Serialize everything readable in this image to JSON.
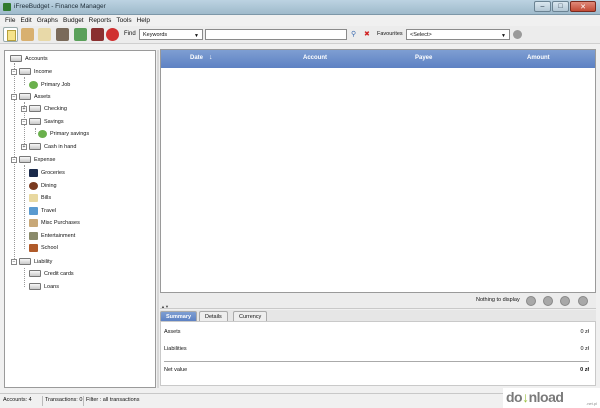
{
  "window": {
    "title": "iFreeBudget - Finance Manager"
  },
  "menu": [
    "File",
    "Edit",
    "Graphs",
    "Budget",
    "Reports",
    "Tools",
    "Help"
  ],
  "toolbar": {
    "find_label": "Find",
    "find_select": "Keywords",
    "find_value": "",
    "favourites_label": "Favourites",
    "favourites_select": "<Select>"
  },
  "tree": {
    "root": "Accounts",
    "income": "Income",
    "primary_job": "Primary Job",
    "assets": "Assets",
    "checking": "Checking",
    "savings": "Savings",
    "primary_savings": "Primary savings",
    "cash_in_hand": "Cash in hand",
    "expense": "Expense",
    "groceries": "Groceries",
    "dining": "Dining",
    "bills": "Bills",
    "travel": "Travel",
    "misc": "Misc Purchases",
    "entertainment": "Entertainment",
    "school": "School",
    "liability": "Liability",
    "credit_cards": "Credit cards",
    "loans": "Loans"
  },
  "table": {
    "columns": [
      "Date",
      "Account",
      "Payee",
      "Amount"
    ],
    "rows": [],
    "empty_text": "Nothing to display"
  },
  "tabs": [
    "Summary",
    "Details",
    "Currency"
  ],
  "summary": {
    "assets_label": "Assets",
    "assets_value": "0 zł",
    "liabilities_label": "Liabilities",
    "liabilities_value": "0 zł",
    "net_label": "Net value",
    "net_value": "0 zł"
  },
  "status": {
    "accounts": "Accounts: 4",
    "transactions": "Transactions: 0",
    "filter": "Filter : all transactions"
  },
  "watermark": {
    "brand": "do",
    "brand2": "nload",
    "domain": ".net.pl"
  }
}
